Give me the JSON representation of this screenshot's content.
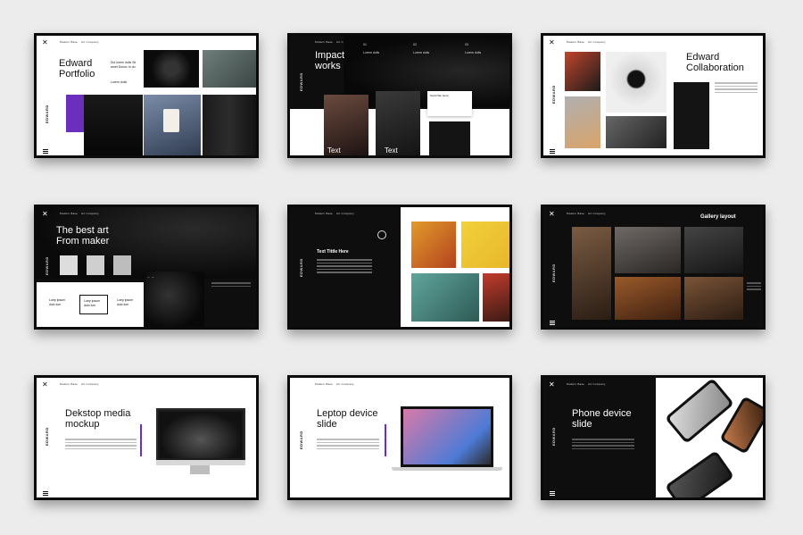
{
  "brand": "EDWARD",
  "nav": [
    "Modern Base",
    "Art Company"
  ],
  "slide1": {
    "title": "Edward Portfolio",
    "small_text": "Dui lorem dulls Sit amet Dolorc In du",
    "link": "Lorem dulls"
  },
  "slide2": {
    "title": "Impact works",
    "numbers": [
      "01",
      "02",
      "03"
    ],
    "item": "Lorem dulls",
    "label_a": "Text",
    "label_b": "Text",
    "card_title": "Scelt Nfer Here"
  },
  "slide3": {
    "title": "Edward Collaboration"
  },
  "slide4": {
    "title": "The best art From maker",
    "box_text": "Loep ipsum dolo lum"
  },
  "slide5": {
    "title": "Text Tittle Here"
  },
  "slide6": {
    "title": "Gallery layout"
  },
  "slide7": {
    "title": "Dekstop media mockup"
  },
  "slide8": {
    "title": "Leptop device slide"
  },
  "slide9": {
    "title": "Phone device slide"
  },
  "colors": {
    "accent": "#6b2fbd",
    "dark": "#0e0e0e"
  }
}
